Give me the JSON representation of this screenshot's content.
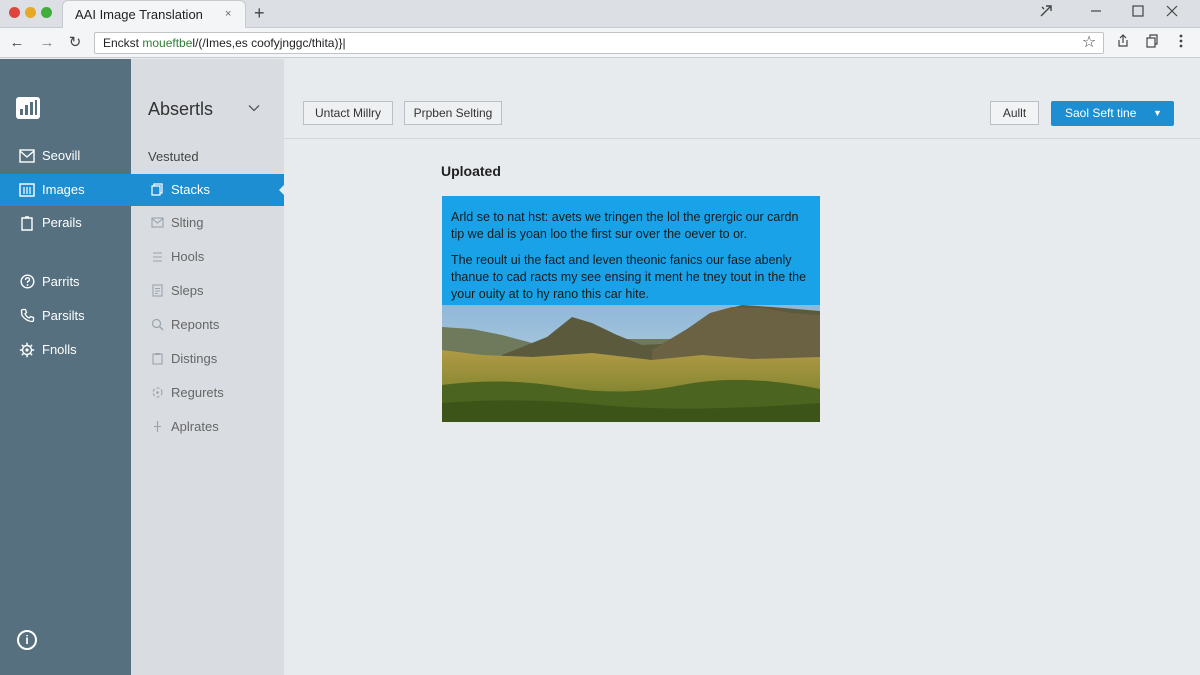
{
  "browser": {
    "tab_title": "AAI Image Translation",
    "tab_close": "×",
    "new_tab": "+",
    "url_prefix": "Enckst ",
    "url_highlight": "moueftbe",
    "url_rest": "l/(/Imes,es coofyjnggc/thita)}|",
    "back_icon": "←",
    "forward_icon": "→",
    "reload_icon": "↻",
    "star_icon": "☆"
  },
  "rail": {
    "items": [
      {
        "icon": "mail-icon",
        "label": "Seovill"
      },
      {
        "icon": "images-icon",
        "label": "Images"
      },
      {
        "icon": "file-icon",
        "label": "Perails"
      },
      {
        "icon": "help-icon",
        "label": "Parrits"
      },
      {
        "icon": "phone-icon",
        "label": "Parsilts"
      },
      {
        "icon": "gear-icon",
        "label": "Fnolls"
      }
    ],
    "info": "i"
  },
  "sidebar": {
    "heading": "Absertls",
    "items": [
      {
        "label": "Vestuted"
      },
      {
        "label": "Stacks"
      },
      {
        "label": "Slting"
      },
      {
        "label": "Hools"
      },
      {
        "label": "Sleps"
      },
      {
        "label": "Reponts"
      },
      {
        "label": "Distings"
      },
      {
        "label": "Regurets"
      },
      {
        "label": "Aplrates"
      }
    ]
  },
  "toolbar": {
    "btn1": "Untact Millry",
    "btn2": "Prpben Selting",
    "audit": "Aullt",
    "primary": "Saol Seft tine",
    "primary_caret": "▼"
  },
  "content": {
    "title": "Uploated",
    "para1": "Arld se to nat hst: avets we tringen the lol the grergic our cardn tip we dal is yoan loo the first sur over the oever to or.",
    "para2": "The reoult ui the fact and leven theonic fanics our fase abenly thanue to cad racts my see ensing it ment he tney tout in the the your ouity at to hy rano this car hite."
  },
  "colors": {
    "accent": "#1e8ed2",
    "rail_bg": "#56707f",
    "sidebar_bg": "#d9dde1",
    "overlay_bg": "#1aa2e8"
  }
}
